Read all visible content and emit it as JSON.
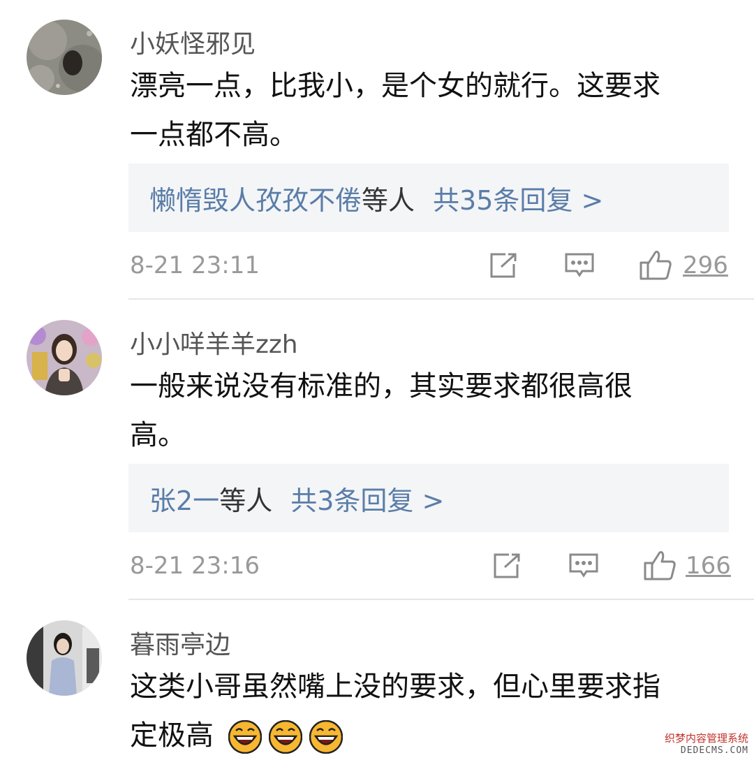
{
  "comments": [
    {
      "username": "小妖怪邪见",
      "text_line1": "漂亮一点，比我小，是个女的就行。这要求",
      "text_line2": "一点都不高。",
      "reply_names": "懒惰毁人孜孜不倦",
      "reply_suffix": "等人",
      "reply_count": "共35条回复 >",
      "time": "8-21 23:11",
      "likes": "296",
      "avatar": "avatar-ground-photo"
    },
    {
      "username": "小小咩羊羊zzh",
      "text_line1": "一般来说没有标准的，其实要求都很高很",
      "text_line2": "高。",
      "reply_names": "张2一",
      "reply_suffix": "等人",
      "reply_count": "共3条回复 >",
      "time": "8-21 23:16",
      "likes": "166",
      "avatar": "avatar-woman-balloons"
    },
    {
      "username": "暮雨亭边",
      "text_line1": "这类小哥虽然嘴上没的要求，但心里要求指",
      "text_line2": "定极高",
      "avatar": "avatar-woman-standing",
      "emojis": [
        "grinning-face",
        "grinning-face",
        "grinning-face"
      ]
    }
  ],
  "icons": {
    "share": "share-icon",
    "comment": "comment-icon",
    "like": "thumbs-up-icon"
  },
  "watermark": {
    "line1": "织梦内容管理系统",
    "line2": "DEDECMS.COM"
  }
}
